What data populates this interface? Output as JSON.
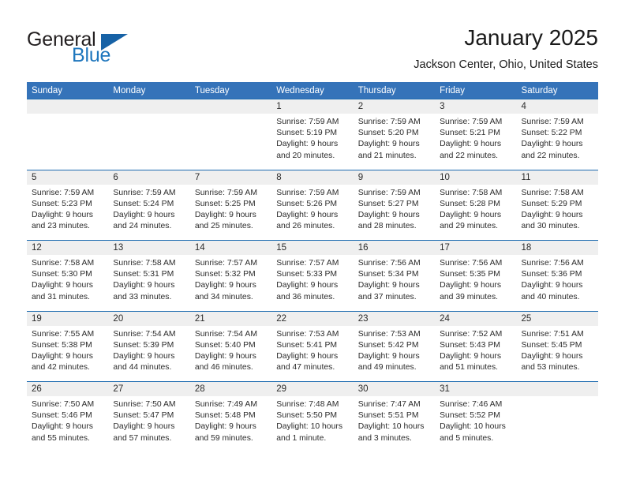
{
  "brand": {
    "name_top": "General",
    "name_bottom": "Blue",
    "triangle_icon": "blue-triangle-icon",
    "color_dark": "#231f20",
    "color_blue": "#1e76bd"
  },
  "header": {
    "title": "January 2025",
    "location": "Jackson Center, Ohio, United States"
  },
  "theme": {
    "header_blue": "#3573b9",
    "divider_blue": "#1f6cb0",
    "day_strip_gray": "#efefef",
    "text_dark": "#2b2b2b"
  },
  "calendar": {
    "weekdays": [
      "Sunday",
      "Monday",
      "Tuesday",
      "Wednesday",
      "Thursday",
      "Friday",
      "Saturday"
    ],
    "weeks": [
      [
        {
          "day": "",
          "sunrise": "",
          "sunset": "",
          "daylight": "",
          "empty": true
        },
        {
          "day": "",
          "sunrise": "",
          "sunset": "",
          "daylight": "",
          "empty": true
        },
        {
          "day": "",
          "sunrise": "",
          "sunset": "",
          "daylight": "",
          "empty": true
        },
        {
          "day": "1",
          "sunrise": "Sunrise: 7:59 AM",
          "sunset": "Sunset: 5:19 PM",
          "daylight": "Daylight: 9 hours and 20 minutes.",
          "empty": false
        },
        {
          "day": "2",
          "sunrise": "Sunrise: 7:59 AM",
          "sunset": "Sunset: 5:20 PM",
          "daylight": "Daylight: 9 hours and 21 minutes.",
          "empty": false
        },
        {
          "day": "3",
          "sunrise": "Sunrise: 7:59 AM",
          "sunset": "Sunset: 5:21 PM",
          "daylight": "Daylight: 9 hours and 22 minutes.",
          "empty": false
        },
        {
          "day": "4",
          "sunrise": "Sunrise: 7:59 AM",
          "sunset": "Sunset: 5:22 PM",
          "daylight": "Daylight: 9 hours and 22 minutes.",
          "empty": false
        }
      ],
      [
        {
          "day": "5",
          "sunrise": "Sunrise: 7:59 AM",
          "sunset": "Sunset: 5:23 PM",
          "daylight": "Daylight: 9 hours and 23 minutes.",
          "empty": false
        },
        {
          "day": "6",
          "sunrise": "Sunrise: 7:59 AM",
          "sunset": "Sunset: 5:24 PM",
          "daylight": "Daylight: 9 hours and 24 minutes.",
          "empty": false
        },
        {
          "day": "7",
          "sunrise": "Sunrise: 7:59 AM",
          "sunset": "Sunset: 5:25 PM",
          "daylight": "Daylight: 9 hours and 25 minutes.",
          "empty": false
        },
        {
          "day": "8",
          "sunrise": "Sunrise: 7:59 AM",
          "sunset": "Sunset: 5:26 PM",
          "daylight": "Daylight: 9 hours and 26 minutes.",
          "empty": false
        },
        {
          "day": "9",
          "sunrise": "Sunrise: 7:59 AM",
          "sunset": "Sunset: 5:27 PM",
          "daylight": "Daylight: 9 hours and 28 minutes.",
          "empty": false
        },
        {
          "day": "10",
          "sunrise": "Sunrise: 7:58 AM",
          "sunset": "Sunset: 5:28 PM",
          "daylight": "Daylight: 9 hours and 29 minutes.",
          "empty": false
        },
        {
          "day": "11",
          "sunrise": "Sunrise: 7:58 AM",
          "sunset": "Sunset: 5:29 PM",
          "daylight": "Daylight: 9 hours and 30 minutes.",
          "empty": false
        }
      ],
      [
        {
          "day": "12",
          "sunrise": "Sunrise: 7:58 AM",
          "sunset": "Sunset: 5:30 PM",
          "daylight": "Daylight: 9 hours and 31 minutes.",
          "empty": false
        },
        {
          "day": "13",
          "sunrise": "Sunrise: 7:58 AM",
          "sunset": "Sunset: 5:31 PM",
          "daylight": "Daylight: 9 hours and 33 minutes.",
          "empty": false
        },
        {
          "day": "14",
          "sunrise": "Sunrise: 7:57 AM",
          "sunset": "Sunset: 5:32 PM",
          "daylight": "Daylight: 9 hours and 34 minutes.",
          "empty": false
        },
        {
          "day": "15",
          "sunrise": "Sunrise: 7:57 AM",
          "sunset": "Sunset: 5:33 PM",
          "daylight": "Daylight: 9 hours and 36 minutes.",
          "empty": false
        },
        {
          "day": "16",
          "sunrise": "Sunrise: 7:56 AM",
          "sunset": "Sunset: 5:34 PM",
          "daylight": "Daylight: 9 hours and 37 minutes.",
          "empty": false
        },
        {
          "day": "17",
          "sunrise": "Sunrise: 7:56 AM",
          "sunset": "Sunset: 5:35 PM",
          "daylight": "Daylight: 9 hours and 39 minutes.",
          "empty": false
        },
        {
          "day": "18",
          "sunrise": "Sunrise: 7:56 AM",
          "sunset": "Sunset: 5:36 PM",
          "daylight": "Daylight: 9 hours and 40 minutes.",
          "empty": false
        }
      ],
      [
        {
          "day": "19",
          "sunrise": "Sunrise: 7:55 AM",
          "sunset": "Sunset: 5:38 PM",
          "daylight": "Daylight: 9 hours and 42 minutes.",
          "empty": false
        },
        {
          "day": "20",
          "sunrise": "Sunrise: 7:54 AM",
          "sunset": "Sunset: 5:39 PM",
          "daylight": "Daylight: 9 hours and 44 minutes.",
          "empty": false
        },
        {
          "day": "21",
          "sunrise": "Sunrise: 7:54 AM",
          "sunset": "Sunset: 5:40 PM",
          "daylight": "Daylight: 9 hours and 46 minutes.",
          "empty": false
        },
        {
          "day": "22",
          "sunrise": "Sunrise: 7:53 AM",
          "sunset": "Sunset: 5:41 PM",
          "daylight": "Daylight: 9 hours and 47 minutes.",
          "empty": false
        },
        {
          "day": "23",
          "sunrise": "Sunrise: 7:53 AM",
          "sunset": "Sunset: 5:42 PM",
          "daylight": "Daylight: 9 hours and 49 minutes.",
          "empty": false
        },
        {
          "day": "24",
          "sunrise": "Sunrise: 7:52 AM",
          "sunset": "Sunset: 5:43 PM",
          "daylight": "Daylight: 9 hours and 51 minutes.",
          "empty": false
        },
        {
          "day": "25",
          "sunrise": "Sunrise: 7:51 AM",
          "sunset": "Sunset: 5:45 PM",
          "daylight": "Daylight: 9 hours and 53 minutes.",
          "empty": false
        }
      ],
      [
        {
          "day": "26",
          "sunrise": "Sunrise: 7:50 AM",
          "sunset": "Sunset: 5:46 PM",
          "daylight": "Daylight: 9 hours and 55 minutes.",
          "empty": false
        },
        {
          "day": "27",
          "sunrise": "Sunrise: 7:50 AM",
          "sunset": "Sunset: 5:47 PM",
          "daylight": "Daylight: 9 hours and 57 minutes.",
          "empty": false
        },
        {
          "day": "28",
          "sunrise": "Sunrise: 7:49 AM",
          "sunset": "Sunset: 5:48 PM",
          "daylight": "Daylight: 9 hours and 59 minutes.",
          "empty": false
        },
        {
          "day": "29",
          "sunrise": "Sunrise: 7:48 AM",
          "sunset": "Sunset: 5:50 PM",
          "daylight": "Daylight: 10 hours and 1 minute.",
          "empty": false
        },
        {
          "day": "30",
          "sunrise": "Sunrise: 7:47 AM",
          "sunset": "Sunset: 5:51 PM",
          "daylight": "Daylight: 10 hours and 3 minutes.",
          "empty": false
        },
        {
          "day": "31",
          "sunrise": "Sunrise: 7:46 AM",
          "sunset": "Sunset: 5:52 PM",
          "daylight": "Daylight: 10 hours and 5 minutes.",
          "empty": false
        },
        {
          "day": "",
          "sunrise": "",
          "sunset": "",
          "daylight": "",
          "empty": true
        }
      ]
    ]
  }
}
